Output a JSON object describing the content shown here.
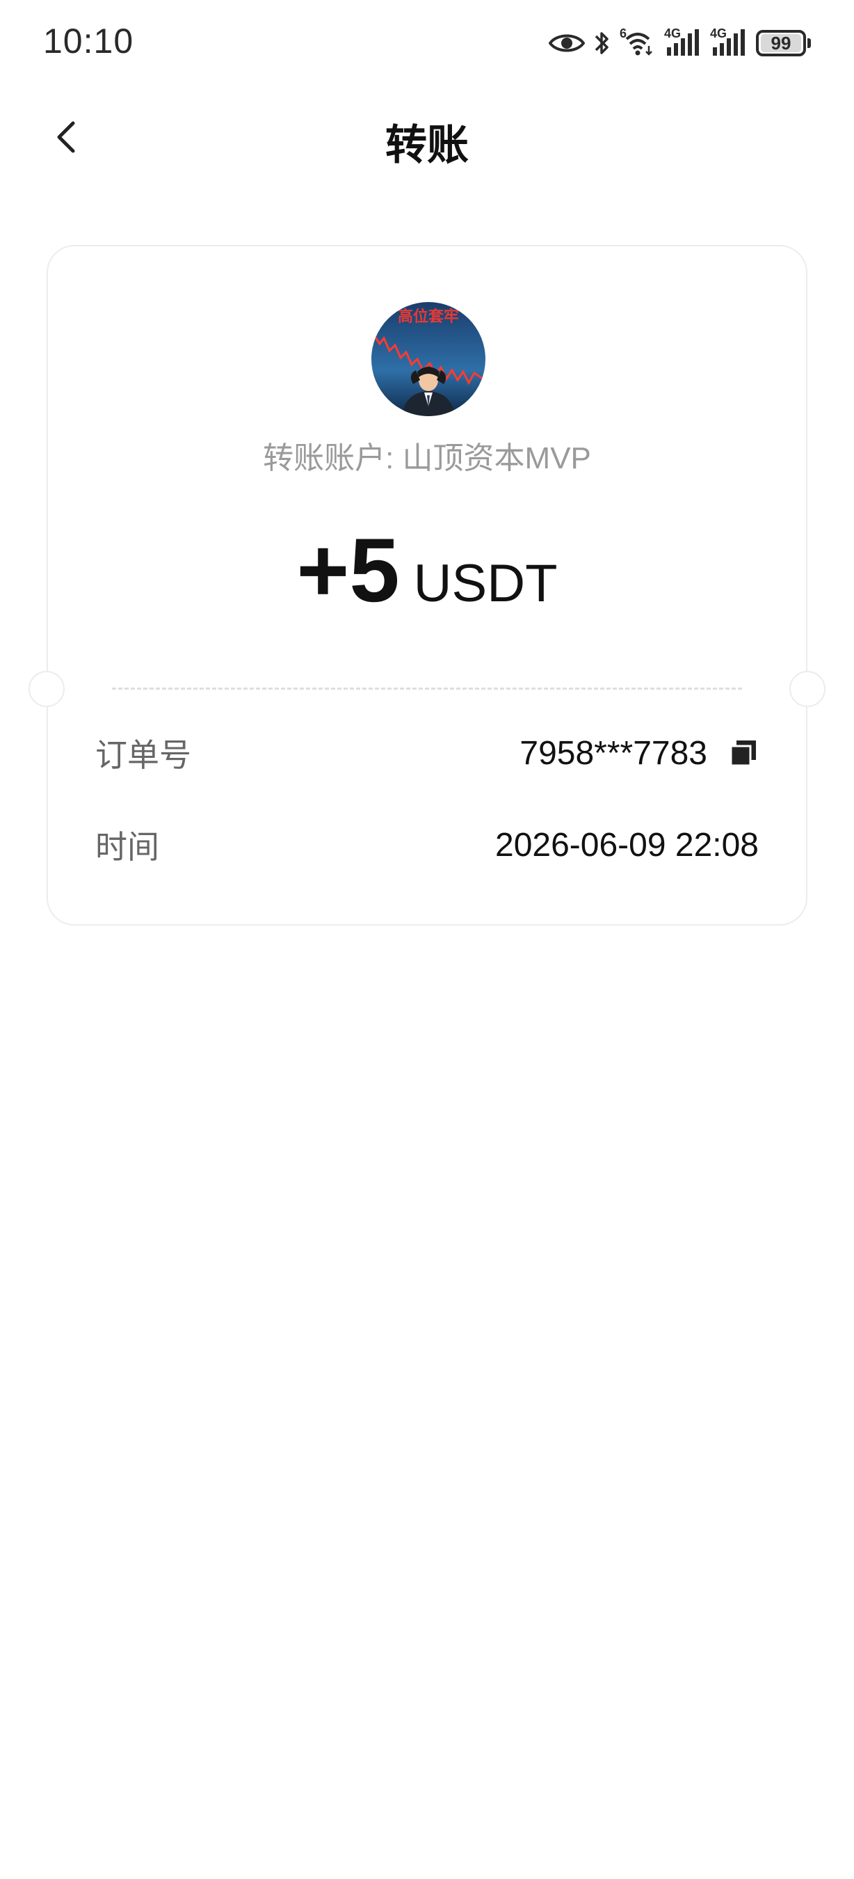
{
  "status_bar": {
    "time": "10:10",
    "signal_1_tag": "6",
    "signal_2_tag": "4G",
    "signal_3_tag": "4G",
    "battery_level": "99"
  },
  "header": {
    "title": "转账",
    "back_icon": "chevron-left-icon"
  },
  "transfer": {
    "avatar_caption": "高位套牢",
    "account_text": "转账账户: 山顶资本MVP",
    "amount": "+5",
    "currency": "USDT"
  },
  "details": {
    "order_label": "订单号",
    "order_value": "7958***7783",
    "time_label": "时间",
    "time_value": "2026-06-09 22:08",
    "copy_icon": "copy-icon"
  },
  "colors": {
    "text_primary": "#111111",
    "text_secondary": "#9a9a9a",
    "label": "#666666",
    "card_border": "#ececec"
  }
}
